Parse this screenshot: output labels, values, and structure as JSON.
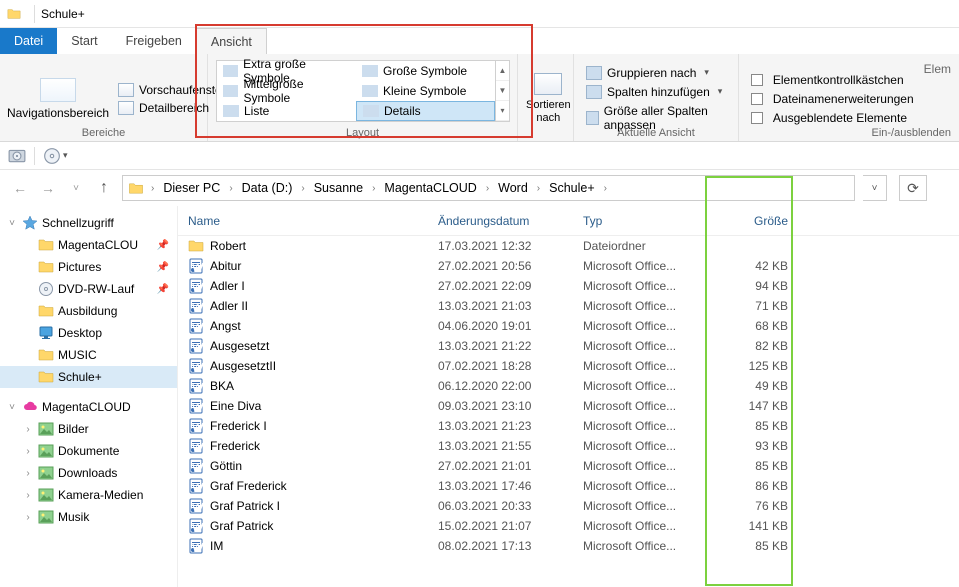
{
  "title": "Schule+",
  "tabs": {
    "datei": "Datei",
    "start": "Start",
    "freigeben": "Freigeben",
    "ansicht": "Ansicht"
  },
  "ribbon": {
    "bereiche": {
      "label": "Bereiche",
      "nav": "Navigationsbereich",
      "vorschau": "Vorschaufenster",
      "detail": "Detailbereich"
    },
    "layout": {
      "label": "Layout",
      "items": [
        "Extra große Symbole",
        "Große Symbole",
        "Mittelgroße Symbole",
        "Kleine Symbole",
        "Liste",
        "Details"
      ]
    },
    "sortieren": {
      "btn": "Sortieren nach"
    },
    "aktuelle": {
      "label": "Aktuelle Ansicht",
      "grupp": "Gruppieren nach",
      "spalten": "Spalten hinzufügen",
      "groesse": "Größe aller Spalten anpassen"
    },
    "einaus": {
      "label": "Ein-/ausblenden",
      "elemk": "Elementkontrollkästchen",
      "dne": "Dateinamenerweiterungen",
      "ausg": "Ausgeblendete Elemente",
      "elem": "Elem"
    }
  },
  "breadcrumbs": [
    "Dieser PC",
    "Data (D:)",
    "Susanne",
    "MagentaCLOUD",
    "Word",
    "Schule+"
  ],
  "columns": {
    "name": "Name",
    "date": "Änderungsdatum",
    "type": "Typ",
    "size": "Größe"
  },
  "quick": {
    "header": "Schnellzugriff",
    "items": [
      {
        "label": "MagentaCLOU",
        "pin": true,
        "icon": "folder"
      },
      {
        "label": "Pictures",
        "pin": true,
        "icon": "folder"
      },
      {
        "label": "DVD-RW-Lauf",
        "pin": true,
        "icon": "disc"
      },
      {
        "label": "Ausbildung",
        "pin": false,
        "icon": "folder"
      },
      {
        "label": "Desktop",
        "pin": false,
        "icon": "desktop"
      },
      {
        "label": "MUSIC",
        "pin": false,
        "icon": "folder"
      },
      {
        "label": "Schule+",
        "pin": false,
        "icon": "folder",
        "sel": true
      }
    ],
    "magenta": "MagentaCLOUD",
    "magenta_items": [
      "Bilder",
      "Dokumente",
      "Downloads",
      "Kamera-Medien",
      "Musik"
    ]
  },
  "files": [
    {
      "name": "Robert",
      "date": "17.03.2021 12:32",
      "type": "Dateiordner",
      "size": "",
      "kind": "folder"
    },
    {
      "name": "Abitur",
      "date": "27.02.2021 20:56",
      "type": "Microsoft Office...",
      "size": "42 KB",
      "kind": "doc"
    },
    {
      "name": "Adler I",
      "date": "27.02.2021 22:09",
      "type": "Microsoft Office...",
      "size": "94 KB",
      "kind": "doc"
    },
    {
      "name": "Adler II",
      "date": "13.03.2021 21:03",
      "type": "Microsoft Office...",
      "size": "71 KB",
      "kind": "doc"
    },
    {
      "name": "Angst",
      "date": "04.06.2020 19:01",
      "type": "Microsoft Office...",
      "size": "68 KB",
      "kind": "doc"
    },
    {
      "name": "Ausgesetzt",
      "date": "13.03.2021 21:22",
      "type": "Microsoft Office...",
      "size": "82 KB",
      "kind": "doc"
    },
    {
      "name": "AusgesetztII",
      "date": "07.02.2021 18:28",
      "type": "Microsoft Office...",
      "size": "125 KB",
      "kind": "doc"
    },
    {
      "name": "BKA",
      "date": "06.12.2020 22:00",
      "type": "Microsoft Office...",
      "size": "49 KB",
      "kind": "doc"
    },
    {
      "name": "Eine Diva",
      "date": "09.03.2021 23:10",
      "type": "Microsoft Office...",
      "size": "147 KB",
      "kind": "doc"
    },
    {
      "name": "Frederick I",
      "date": "13.03.2021 21:23",
      "type": "Microsoft Office...",
      "size": "85 KB",
      "kind": "doc"
    },
    {
      "name": "Frederick",
      "date": "13.03.2021 21:55",
      "type": "Microsoft Office...",
      "size": "93 KB",
      "kind": "doc"
    },
    {
      "name": "Göttin",
      "date": "27.02.2021 21:01",
      "type": "Microsoft Office...",
      "size": "85 KB",
      "kind": "doc"
    },
    {
      "name": "Graf Frederick",
      "date": "13.03.2021 17:46",
      "type": "Microsoft Office...",
      "size": "86 KB",
      "kind": "doc"
    },
    {
      "name": "Graf Patrick I",
      "date": "06.03.2021 20:33",
      "type": "Microsoft Office...",
      "size": "76 KB",
      "kind": "doc"
    },
    {
      "name": "Graf Patrick",
      "date": "15.02.2021 21:07",
      "type": "Microsoft Office...",
      "size": "141 KB",
      "kind": "doc"
    },
    {
      "name": "IM",
      "date": "08.02.2021 17:13",
      "type": "Microsoft Office...",
      "size": "85 KB",
      "kind": "doc"
    }
  ]
}
